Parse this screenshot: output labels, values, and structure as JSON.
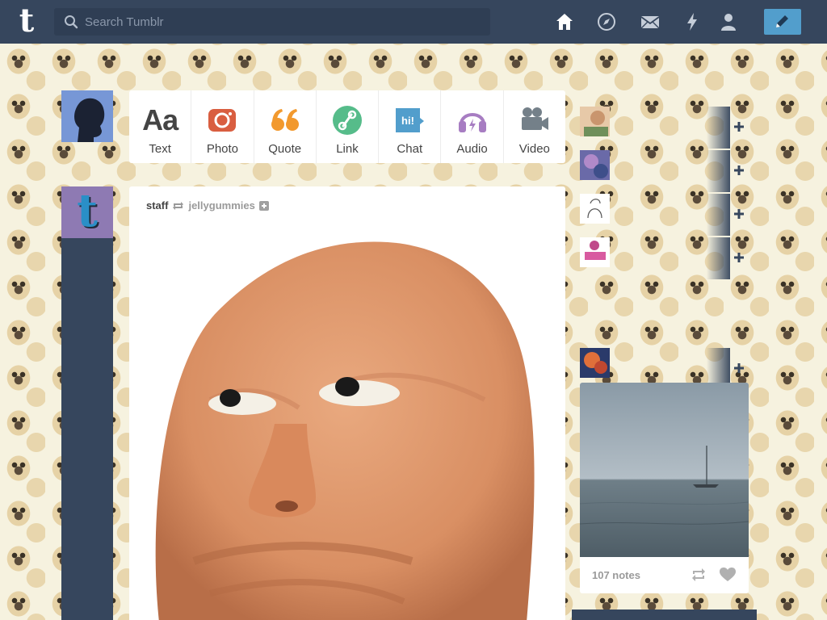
{
  "header": {
    "logo_letter": "t",
    "search_placeholder": "Search Tumblr",
    "nav_icons": [
      "home-icon",
      "explore-icon",
      "inbox-icon",
      "activity-icon",
      "account-icon"
    ],
    "compose_icon": "pencil-icon",
    "accent_color": "#529ecc",
    "bar_color": "#36465d"
  },
  "left": {
    "staff_letter": "t"
  },
  "post_types": [
    {
      "label": "Text",
      "icon": "text-icon",
      "glyph": "Aa",
      "color": "#444444"
    },
    {
      "label": "Photo",
      "icon": "camera-icon",
      "color": "#d95e40"
    },
    {
      "label": "Quote",
      "icon": "quote-icon",
      "color": "#f2992e"
    },
    {
      "label": "Link",
      "icon": "link-icon",
      "color": "#56bc8a"
    },
    {
      "label": "Chat",
      "icon": "chat-icon",
      "glyph": "hi!",
      "color": "#529ecc"
    },
    {
      "label": "Audio",
      "icon": "headphones-icon",
      "color": "#a77dc2"
    },
    {
      "label": "Video",
      "icon": "video-camera-icon",
      "color": "#748089"
    }
  ],
  "post": {
    "author": "staff",
    "reblogged_from": "jellygummies"
  },
  "radar": {
    "notes": "107 notes"
  }
}
